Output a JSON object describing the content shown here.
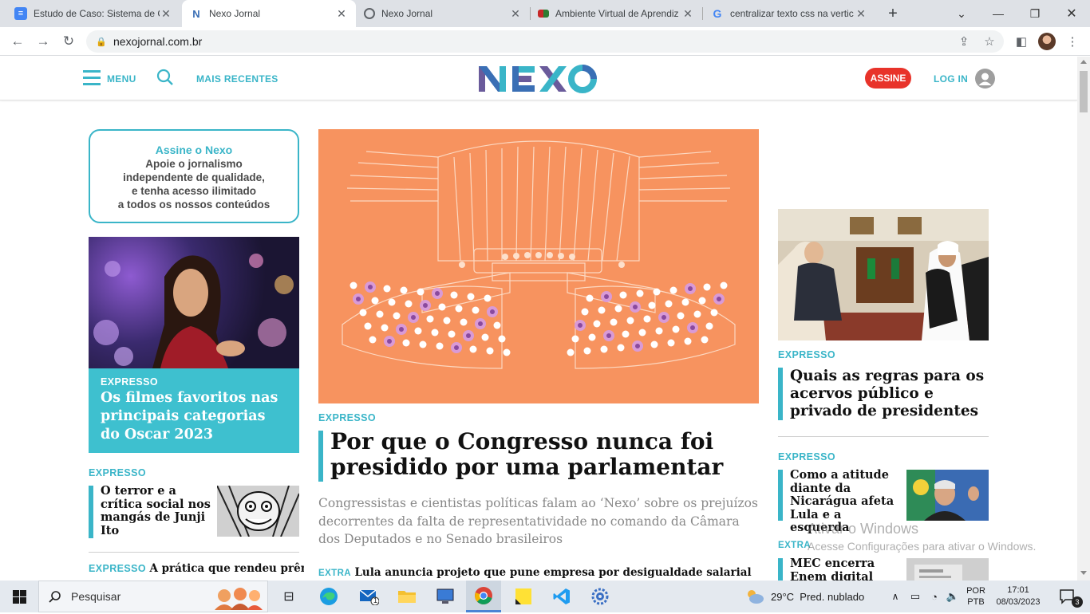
{
  "browser": {
    "tabs": [
      {
        "title": "Estudo de Caso: Sistema de C",
        "favicon": "docs-icon",
        "active": false
      },
      {
        "title": "Nexo Jornal",
        "favicon": "nexo-icon",
        "active": true
      },
      {
        "title": "Nexo Jornal",
        "favicon": "globe-icon",
        "active": false
      },
      {
        "title": "Ambiente Virtual de Aprendiz",
        "favicon": "ava-icon",
        "active": false
      },
      {
        "title": "centralizar texto css na vertic",
        "favicon": "google-icon",
        "active": false
      }
    ],
    "url": "nexojornal.com.br"
  },
  "site": {
    "menu_label": "MENU",
    "recent_label": "MAIS RECENTES",
    "logo_text": "NEXO",
    "subscribe_label": "ASSINE",
    "login_label": "LOG IN"
  },
  "promo": {
    "title": "Assine o Nexo",
    "lines": [
      "Apoie o jornalismo",
      "independente de qualidade,",
      "e tenha acesso ilimitado",
      "a todos os nossos conteúdos"
    ]
  },
  "left": {
    "feature": {
      "kicker": "EXPRESSO",
      "headline": "Os filmes favoritos nas principais categorias do Oscar 2023"
    },
    "story1": {
      "kicker": "EXPRESSO",
      "headline": "O terror e a crítica social nos mangás de Junji Ito"
    },
    "story2": {
      "kicker": "EXPRESSO",
      "headline": "A prática que rendeu prêmio de turismo sustentável a SC"
    }
  },
  "center": {
    "kicker": "EXPRESSO",
    "headline": "Por que o Congresso nunca foi presidido por uma parlamentar",
    "summary": "Congressistas e cientistas políticas falam ao ‘Nexo’ sobre os prejuízos decorrentes da falta de representatividade no comando da Câmara dos Deputados e no Senado brasileiros",
    "extra_kicker": "EXTRA",
    "extra_headline": "Lula anuncia projeto que pune empresa por desigualdade salarial"
  },
  "right": {
    "story1": {
      "kicker": "EXPRESSO",
      "headline": "Quais as regras para os acervos público e privado de presidentes"
    },
    "story2": {
      "kicker": "EXPRESSO",
      "headline": "Como a atitude diante da Nicarágua afeta Lula e a esquerda"
    },
    "story3": {
      "kicker": "EXTRA",
      "headline": "MEC encerra Enem digital"
    }
  },
  "windows_watermark": {
    "line1": "Ativar o Windows",
    "line2": "Acesse Configurações para ativar o Windows."
  },
  "taskbar": {
    "search_placeholder": "Pesquisar",
    "weather": "29°C  Pred. nublado",
    "lang1": "POR",
    "lang2": "PTB",
    "time": "17:01",
    "date": "08/03/2023",
    "notifications": "3",
    "mail_badge": "1"
  },
  "colors": {
    "accent": "#3ab5c8",
    "subscribe": "#e8332a",
    "hero_bg": "#f7935f"
  }
}
